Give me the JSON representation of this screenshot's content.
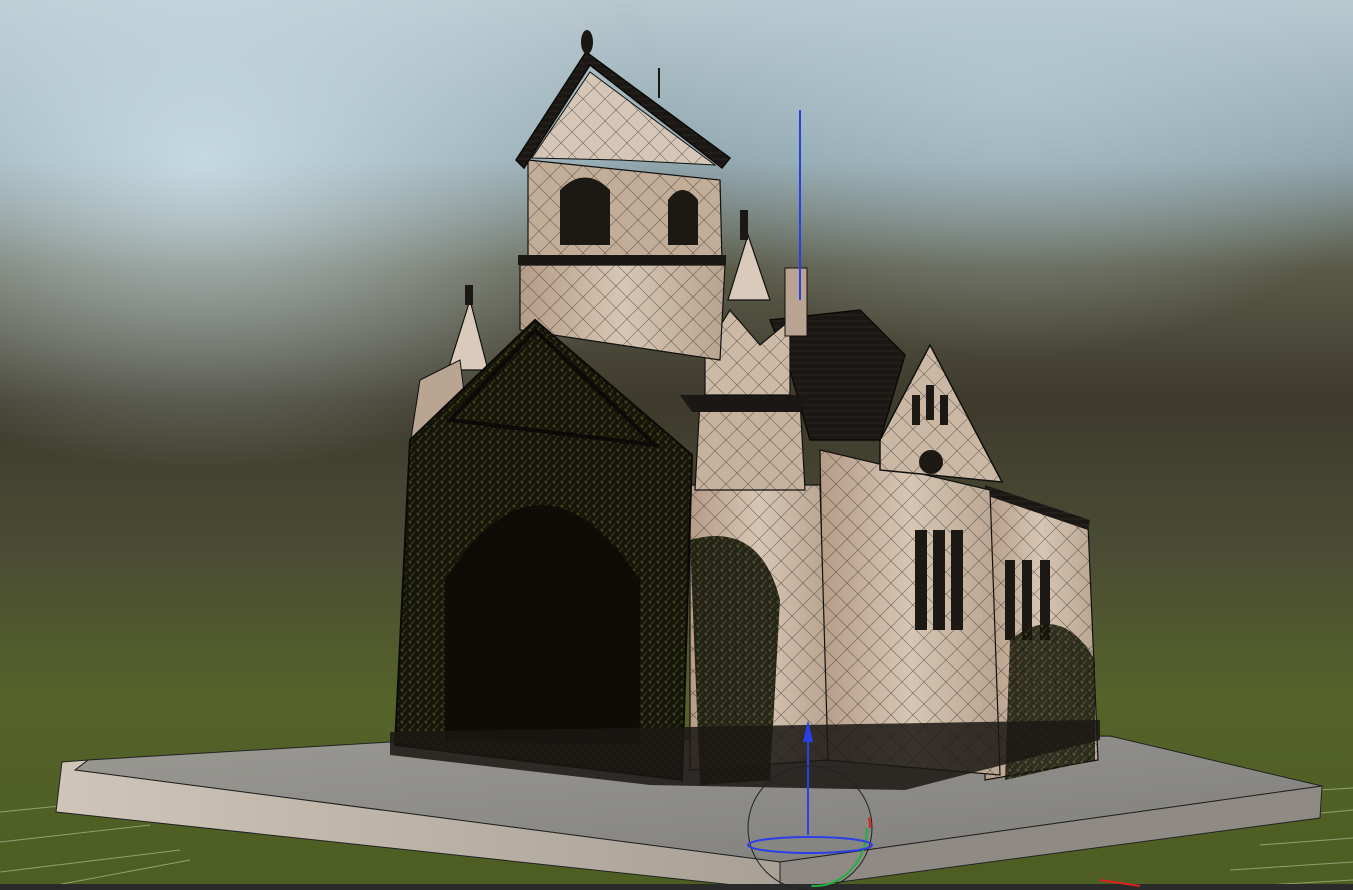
{
  "viewport": {
    "object_name": "",
    "gizmo": "transform-gizmo",
    "colors": {
      "sky_top": "#a9c2cf",
      "haze": "#4a4737",
      "ground": "#5a6a2a",
      "grid": "#c9d3b0",
      "plinth_top": "#8e8d8a",
      "plinth_side": "#bfb6ab",
      "wall": "#c9b6a2",
      "roof": "#1b1714",
      "ivy": "#1a1c10",
      "axis_x": "#e02020",
      "axis_y": "#20b040",
      "axis_z": "#2040e0"
    }
  }
}
